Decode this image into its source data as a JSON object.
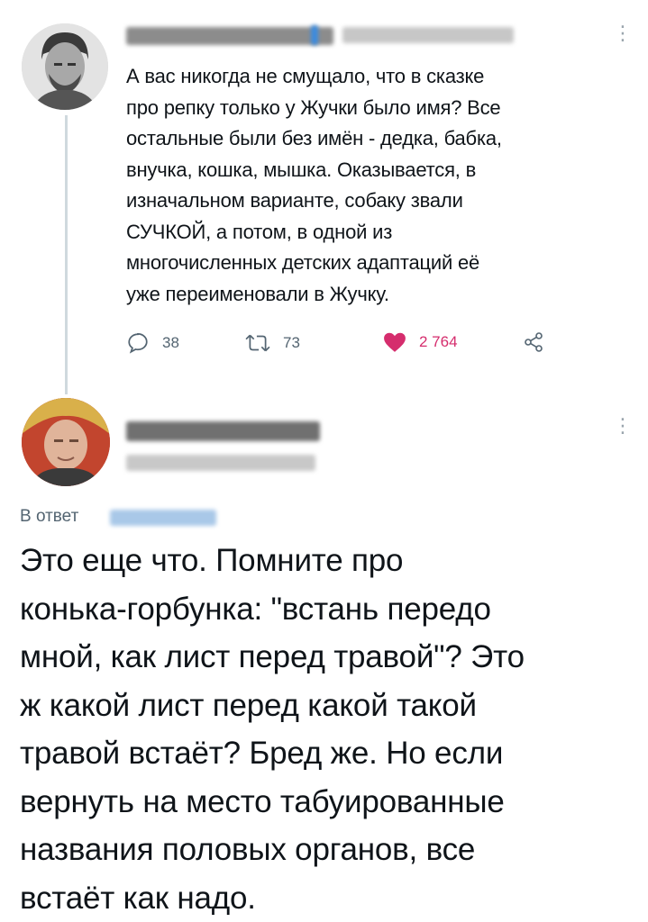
{
  "tweet1": {
    "text": "А вас никогда не смущало, что в сказке\nпро репку только у Жучки было имя? Все\nостальные были без имён - дедка, бабка,\nвнучка, кошка, мышка. Оказывается, в\nизначальном варианте, собаку звали\nСУЧКОЙ, а потом, в одной из\nмногочисленных детских адаптаций её\nуже переименовали в Жучку.",
    "actions": {
      "replies": "38",
      "retweets": "73",
      "likes": "2 764"
    },
    "icons": {
      "reply": "reply-icon",
      "retweet": "retweet-icon",
      "like": "heart-icon",
      "share": "share-icon",
      "more": "more-icon"
    }
  },
  "tweet2": {
    "reply_prefix": "В ответ",
    "text": "Это еще что. Помните про\nконька-горбунка: \"встань передо\nмной, как лист перед травой\"? Это\nж какой лист перед какой такой\nтравой встаёт? Бред же. Но если\nвернуть на место табуированные\nназвания половых органов, все\nвстаёт как надо."
  },
  "colors": {
    "text": "#0f1419",
    "muted": "#536471",
    "like": "#d52d6d",
    "thread": "#cfd9de"
  }
}
